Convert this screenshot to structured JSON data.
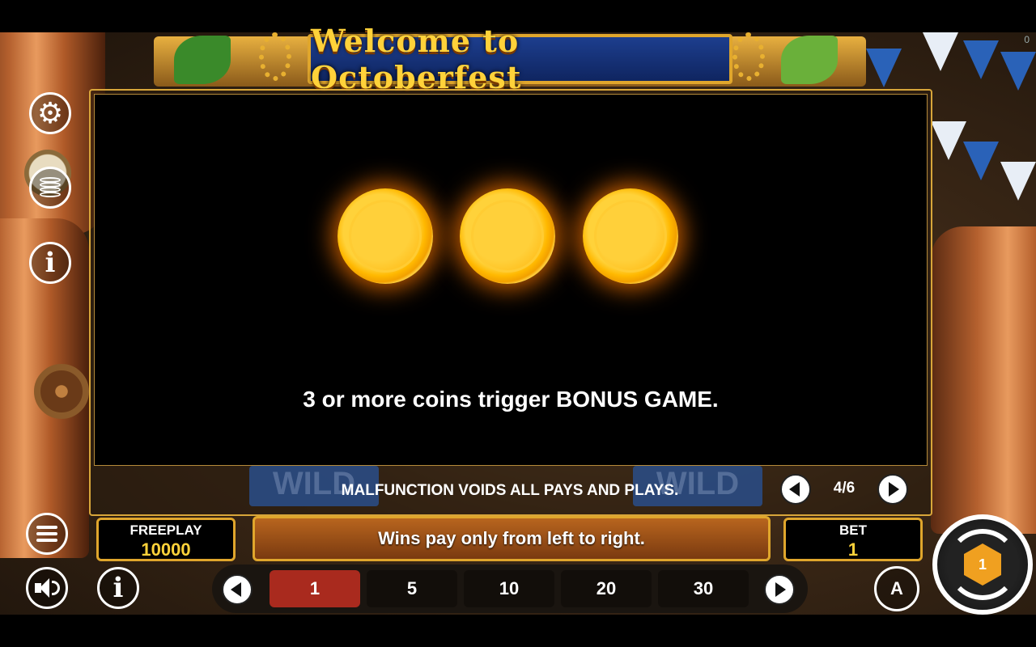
{
  "header": {
    "corner_counter": "0"
  },
  "title": {
    "text": "Welcome to Octoberfest"
  },
  "paytable": {
    "rule_text": "3 or more coins trigger BONUS GAME.",
    "disclaimer": "MALFUNCTION VOIDS ALL PAYS AND PLAYS.",
    "page_indicator": "4/6",
    "background_reel_labels": [
      "WILD",
      "WILD"
    ]
  },
  "balance": {
    "label": "FREEPLAY",
    "value": "10000"
  },
  "message_bar": {
    "text": "Wins pay only from left to right."
  },
  "bet": {
    "label": "BET",
    "value": "1",
    "options": [
      "1",
      "5",
      "10",
      "20",
      "30"
    ],
    "selected": "1"
  },
  "auto": {
    "label": "A"
  },
  "spin": {
    "logo": "1"
  },
  "colors": {
    "accent_gold": "#e0a62c",
    "selected_bet": "#a92a1e",
    "title_blue": "#1d3e8e"
  }
}
